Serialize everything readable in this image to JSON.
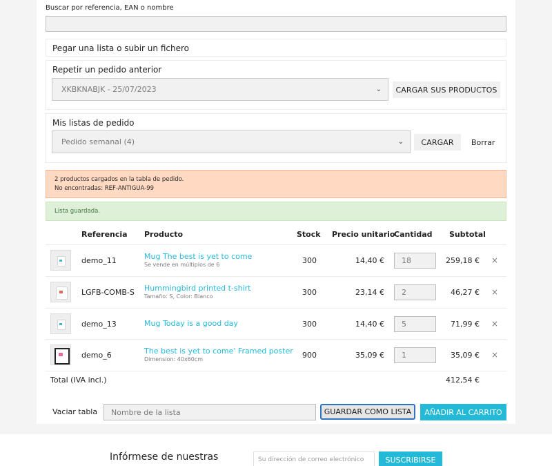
{
  "search": {
    "label": "Buscar por referencia, EAN o nombre",
    "value": ""
  },
  "paste": {
    "title": "Pegar una lista o subir un fichero"
  },
  "repeat_order": {
    "title": "Repetir un pedido anterior",
    "selected": "XKBKNABJK - 25/07/2023",
    "button": "CARGAR SUS PRODUCTOS"
  },
  "order_lists": {
    "title": "Mis listas de pedido",
    "selected": "Pedido semanal (4)",
    "load_button": "CARGAR",
    "delete_link": "Borrar"
  },
  "alerts": {
    "warning_line1": "2 productos cargados en la tabla de pedido.",
    "warning_line2": "No encontradas: REF-ANTIGUA-99",
    "success": "Lista guardada."
  },
  "table": {
    "headers": {
      "reference": "Referencia",
      "product": "Producto",
      "stock": "Stock",
      "unit_price": "Precio unitario",
      "quantity": "Cantidad",
      "subtotal": "Subtotal"
    },
    "rows": [
      {
        "thumb": "mug",
        "reference": "demo_11",
        "name": "Mug The best is yet to come",
        "detail": "Se vende en múltiplos de 6",
        "stock": "300",
        "unit_price": "14,40 €",
        "quantity": "18",
        "subtotal": "259,18 €",
        "remove": "×"
      },
      {
        "thumb": "shirt",
        "reference": "LGFB-COMB-S",
        "name": "Hummingbird printed t-shirt",
        "detail": "Tamaño: S, Color: Blanco",
        "stock": "300",
        "unit_price": "23,14 €",
        "quantity": "2",
        "subtotal": "46,27 €",
        "remove": "×"
      },
      {
        "thumb": "mug",
        "reference": "demo_13",
        "name": "Mug Today is a good day",
        "detail": "",
        "stock": "300",
        "unit_price": "14,40 €",
        "quantity": "5",
        "subtotal": "71,99 €",
        "remove": "×"
      },
      {
        "thumb": "poster",
        "reference": "demo_6",
        "name": "The best is yet to come' Framed poster",
        "detail": "Dimension: 40x60cm",
        "stock": "900",
        "unit_price": "35,09 €",
        "quantity": "1",
        "subtotal": "35,09 €",
        "remove": "×"
      }
    ],
    "total_label": "Total (IVA incl.)",
    "total_value": "412,54 €"
  },
  "actions": {
    "clear_link": "Vaciar tabla",
    "list_name_placeholder": "Nombre de la lista",
    "save_list_button": "GUARDAR COMO LISTA",
    "add_to_cart_button": "AÑADIR AL CARRITO"
  },
  "newsletter": {
    "text": "Infórmese de nuestras",
    "email_placeholder": "Su dirección de correo electrónico",
    "subscribe_button": "SUSCRIBIRSE"
  },
  "colors": {
    "accent": "#24b9d7",
    "warning_bg": "#ffd9c2",
    "success_bg": "#dff0d8",
    "success_text": "#3c763d"
  }
}
